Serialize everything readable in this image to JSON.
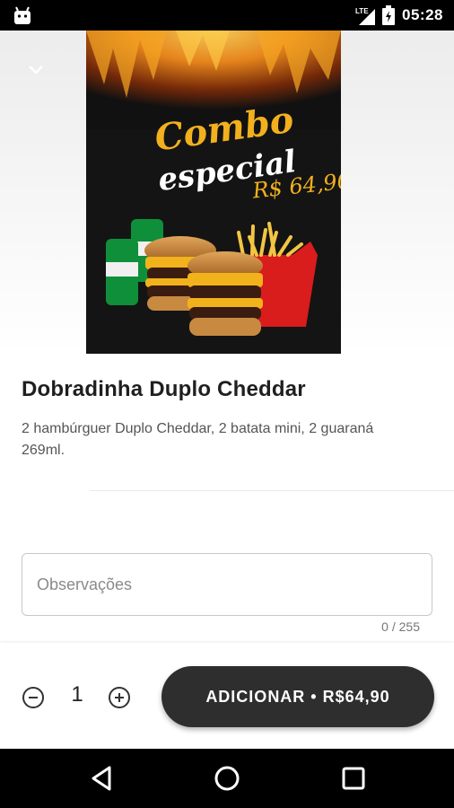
{
  "status_bar": {
    "network": "LTE",
    "time": "05:28"
  },
  "poster": {
    "line1": "Combo",
    "line2": "especial",
    "price": "R$ 64,90"
  },
  "product": {
    "title": "Dobradinha Duplo Cheddar",
    "description": "2 hambúrguer Duplo Cheddar, 2 batata mini, 2 guaraná 269ml."
  },
  "observations": {
    "placeholder": "Observações",
    "value": "",
    "counter": "0 / 255"
  },
  "order": {
    "quantity": "1",
    "add_label": "ADICIONAR • R$64,90"
  },
  "colors": {
    "button": "#2e2e2e",
    "poster_text": "#f2b01e"
  }
}
